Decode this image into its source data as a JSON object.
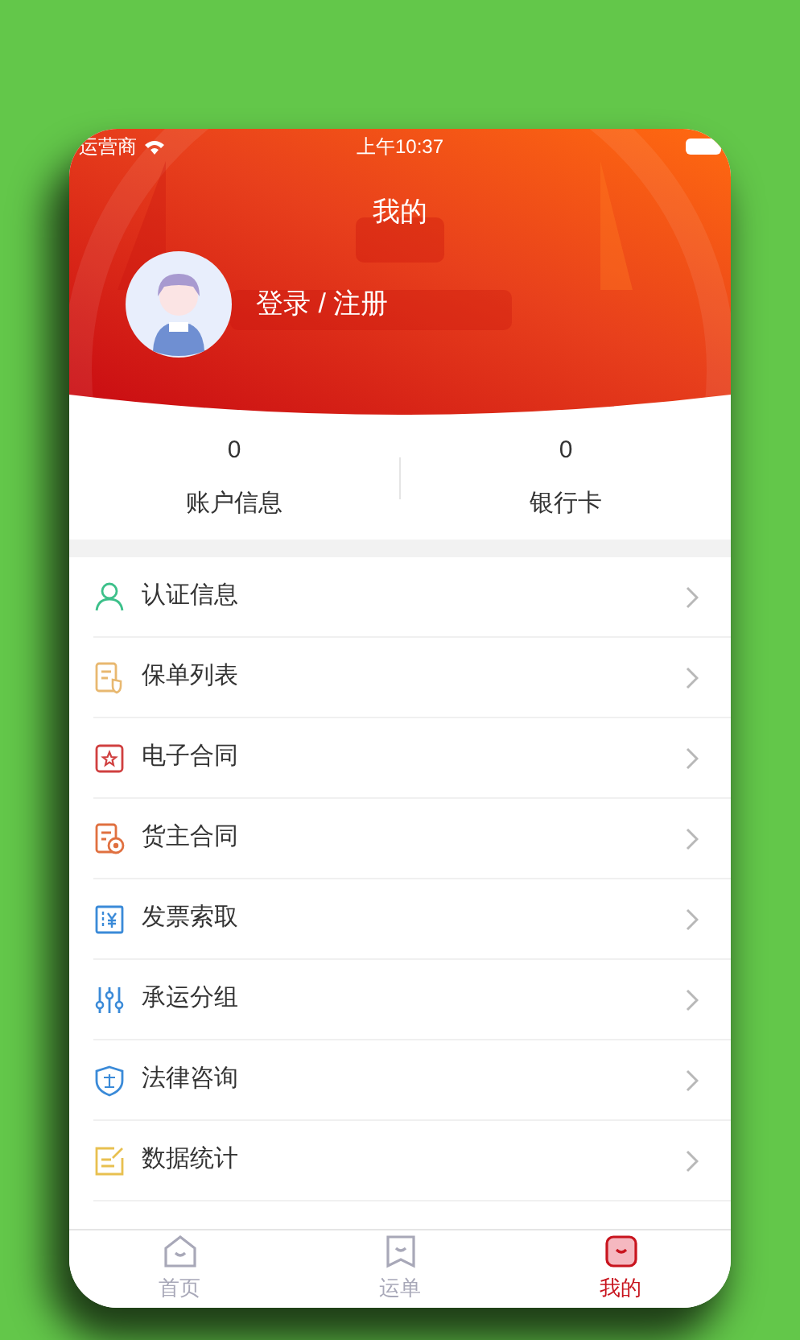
{
  "status_bar": {
    "carrier": "运营商",
    "time": "上午10:37"
  },
  "header": {
    "title": "我的",
    "login": "登录 / 注册"
  },
  "stats": [
    {
      "value": "0",
      "label": "账户信息"
    },
    {
      "value": "0",
      "label": "银行卡"
    }
  ],
  "menu": [
    {
      "label": "认证信息"
    },
    {
      "label": "保单列表"
    },
    {
      "label": "电子合同"
    },
    {
      "label": "货主合同"
    },
    {
      "label": "发票索取"
    },
    {
      "label": "承运分组"
    },
    {
      "label": "法律咨询"
    },
    {
      "label": "数据统计"
    }
  ],
  "tabs": [
    {
      "label": "首页",
      "selected": false
    },
    {
      "label": "运单",
      "selected": false
    },
    {
      "label": "我的",
      "selected": true
    }
  ]
}
